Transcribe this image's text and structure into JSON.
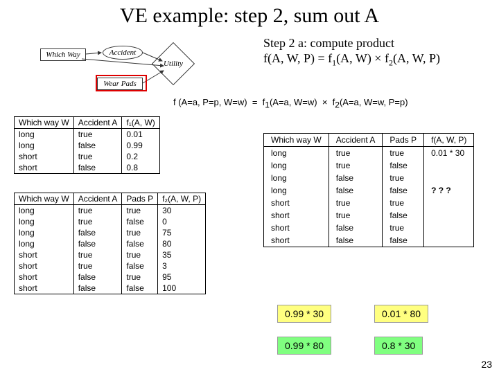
{
  "title": "VE example: step 2, sum out A",
  "step": {
    "line1": "Step 2 a: compute product",
    "line2_pre": "f(A, W, P) = f",
    "line2_s1": "1",
    "line2_mid": "(A, W) × f",
    "line2_s2": "2",
    "line2_post": "(A, W, P)"
  },
  "diagram": {
    "which": "Which Way",
    "accident": "Accident",
    "wear": "Wear Pads",
    "utility": "Utility"
  },
  "formula": {
    "lhs": "f (A=a, P=p, W=w)",
    "eq": "=",
    "f1": "f",
    "s1": "1",
    "mid1": "(A=a, W=w)",
    "times": "×",
    "f2": "f",
    "s2": "2",
    "mid2": "(A=a, W=w, P=p)"
  },
  "t1": {
    "h1": "Which way W",
    "h2": "Accident A",
    "h3": "f₁(A, W)",
    "r": [
      [
        "long",
        "true",
        "0.01"
      ],
      [
        "long",
        "false",
        "0.99"
      ],
      [
        "short",
        "true",
        "0.2"
      ],
      [
        "short",
        "false",
        "0.8"
      ]
    ]
  },
  "t2": {
    "h1": "Which way W",
    "h2": "Accident A",
    "h3": "Pads P",
    "h4": "f₂(A, W, P)",
    "r": [
      [
        "long",
        "true",
        "true",
        "30"
      ],
      [
        "long",
        "true",
        "false",
        "0"
      ],
      [
        "long",
        "false",
        "true",
        "75"
      ],
      [
        "long",
        "false",
        "false",
        "80"
      ],
      [
        "short",
        "true",
        "true",
        "35"
      ],
      [
        "short",
        "true",
        "false",
        "3"
      ],
      [
        "short",
        "false",
        "true",
        "95"
      ],
      [
        "short",
        "false",
        "false",
        "100"
      ]
    ]
  },
  "t3": {
    "h1": "Which way W",
    "h2": "Accident A",
    "h3": "Pads P",
    "h4": "f(A, W, P)",
    "r": [
      [
        "long",
        "true",
        "true",
        "0.01 * 30"
      ],
      [
        "long",
        "true",
        "false",
        ""
      ],
      [
        "long",
        "false",
        "true",
        ""
      ],
      [
        "long",
        "false",
        "false",
        "? ? ?"
      ],
      [
        "short",
        "true",
        "true",
        ""
      ],
      [
        "short",
        "true",
        "false",
        ""
      ],
      [
        "short",
        "false",
        "true",
        ""
      ],
      [
        "short",
        "false",
        "false",
        ""
      ]
    ]
  },
  "calc": {
    "c1": "0.99 * 30",
    "c2": "0.01 * 80",
    "c3": "0.99 * 80",
    "c4": "0.8 * 30"
  },
  "pagenum": "23"
}
